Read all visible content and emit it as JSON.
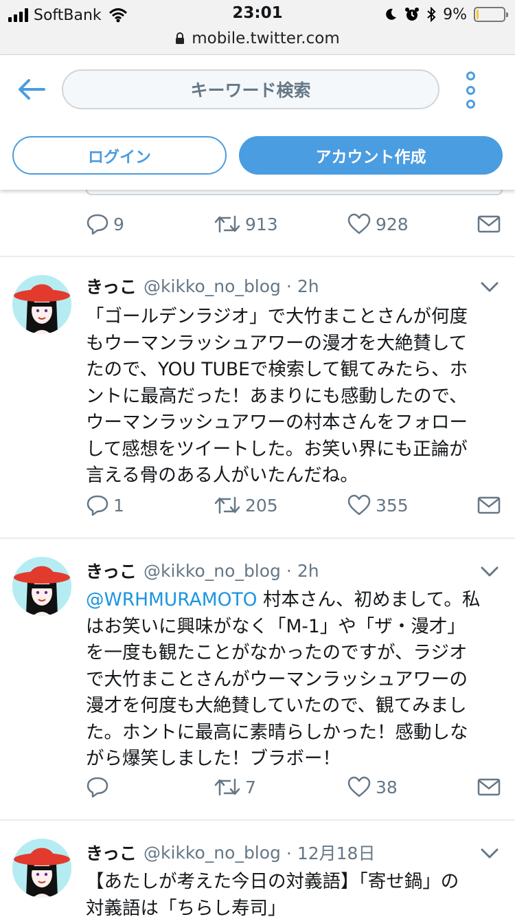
{
  "status_bar": {
    "carrier": "SoftBank",
    "time": "23:01",
    "battery": "9%",
    "battery_level": 0.09,
    "url": "mobile.twitter.com"
  },
  "header": {
    "search_placeholder": "キーワード検索",
    "login_label": "ログイン",
    "signup_label": "アカウント作成"
  },
  "accent_color": "#4a9de0",
  "prev_tweet_actions": {
    "replies": "9",
    "retweets": "913",
    "likes": "928"
  },
  "tweets": [
    {
      "name": "きっこ",
      "handle": "@kikko_no_blog",
      "time": "· 2h",
      "lines": [
        "「ゴールデンラジオ」で大竹まことさんが何度",
        "もウーマンラッシュアワーの漫才を大絶賛して",
        "たので、YOU TUBEで検索して観てみたら、ホ",
        "ントに最高だった！あまりにも感動したので、",
        "ウーマンラッシュアワーの村本さんをフォロー",
        "して感想をツイートした。お笑い界にも正論が",
        "言える骨のある人がいたんだね。"
      ],
      "replies": "1",
      "retweets": "205",
      "likes": "355"
    },
    {
      "name": "きっこ",
      "handle": "@kikko_no_blog",
      "time": "· 2h",
      "mention": "@WRHMURAMOTO",
      "first_line_rest": " 村本さん、初めまして。私",
      "lines": [
        "はお笑いに興味がなく「M-1」や「ザ・漫才」",
        "を一度も観たことがなかったのですが、ラジオ",
        "で大竹まことさんがウーマンラッシュアワーの",
        "漫才を何度も大絶賛していたので、観てみまし",
        "た。ホントに最高に素晴らしかった！感動しな",
        "がら爆笑しました！ブラボー！"
      ],
      "replies": "",
      "retweets": "7",
      "likes": "38"
    },
    {
      "name": "きっこ",
      "handle": "@kikko_no_blog",
      "time": "· 12月18日",
      "lines": [
        "【あたしが考えた今日の対義語】「寄せ鍋」の",
        "対義語は「ちらし寿司」"
      ]
    }
  ]
}
